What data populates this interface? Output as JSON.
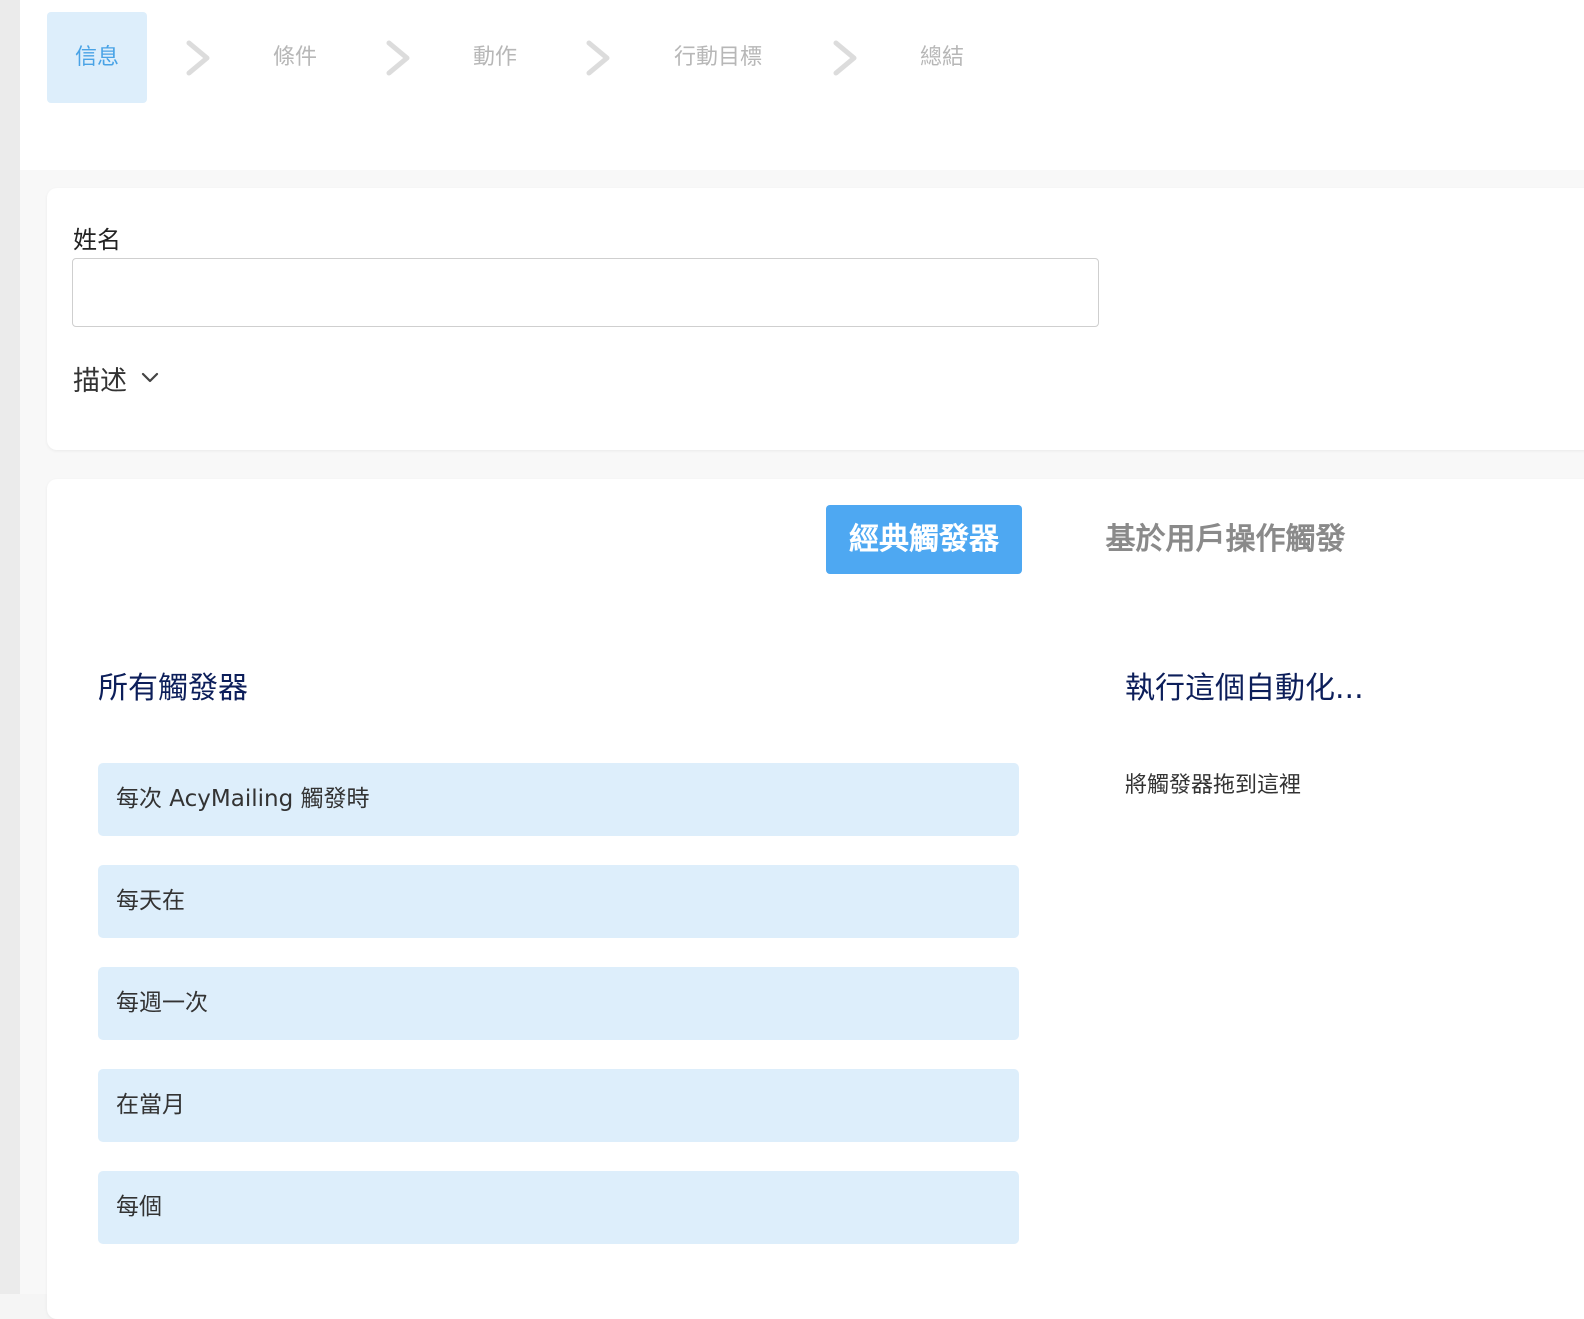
{
  "steps": [
    {
      "label": "信息",
      "active": true
    },
    {
      "label": "條件",
      "active": false
    },
    {
      "label": "動作",
      "active": false
    },
    {
      "label": "行動目標",
      "active": false
    },
    {
      "label": "總結",
      "active": false
    }
  ],
  "info": {
    "name_label": "姓名",
    "name_value": "",
    "description_label": "描述"
  },
  "tabs": {
    "classic": "經典觸發器",
    "user_action": "基於用戶操作觸發"
  },
  "all_triggers": {
    "title": "所有觸發器",
    "items": [
      "每次 AcyMailing 觸發時",
      "每天在",
      "每週一次",
      "在當月",
      "每個"
    ]
  },
  "run_automation": {
    "title": "執行這個自動化...",
    "drop_hint": "將觸發器拖到這裡"
  },
  "colors": {
    "accent": "#4ea8f2",
    "active_step_bg": "#ddeefb",
    "active_step_text": "#49a3e6",
    "heading": "#0c1e5a"
  }
}
